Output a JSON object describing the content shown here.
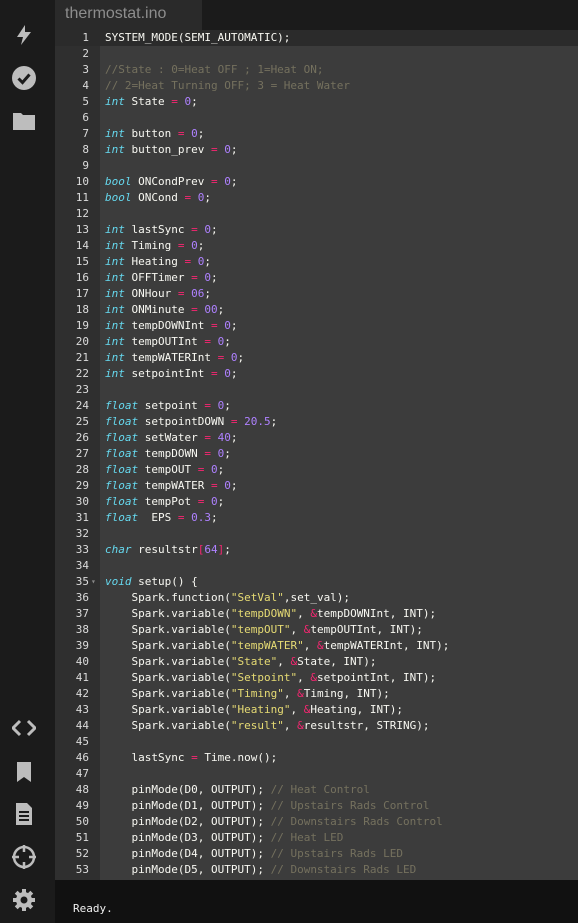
{
  "sidebar": {
    "icons": [
      "flash-icon",
      "verify-icon",
      "folder-icon",
      "code-icon",
      "libraries-icon",
      "docs-icon",
      "devices-icon",
      "settings-icon"
    ]
  },
  "tab": {
    "title": "thermostat.ino"
  },
  "editor": {
    "lines": [
      "SYSTEM_MODE(SEMI_AUTOMATIC);",
      "",
      "//State : 0=Heat OFF ; 1=Heat ON;",
      "// 2=Heat Turning OFF; 3 = Heat Water",
      "int State = 0;",
      "",
      "int button = 0;",
      "int button_prev = 0;",
      "",
      "bool ONCondPrev = 0;",
      "bool ONCond = 0;",
      "",
      "int lastSync = 0;",
      "int Timing = 0;",
      "int Heating = 0;",
      "int OFFTimer = 0;",
      "int ONHour = 06;",
      "int ONMinute = 00;",
      "int tempDOWNInt = 0;",
      "int tempOUTInt = 0;",
      "int tempWATERInt = 0;",
      "int setpointInt = 0;",
      "",
      "float setpoint = 0;",
      "float setpointDOWN = 20.5;",
      "float setWater = 40;",
      "float tempDOWN = 0;",
      "float tempOUT = 0;",
      "float tempWATER = 0;",
      "float tempPot = 0;",
      "float  EPS = 0.3;",
      "",
      "char resultstr[64];",
      "",
      "void setup() {",
      "    Spark.function(\"SetVal\",set_val);",
      "    Spark.variable(\"tempDOWN\", &tempDOWNInt, INT);",
      "    Spark.variable(\"tempOUT\", &tempOUTInt, INT);",
      "    Spark.variable(\"tempWATER\", &tempWATERInt, INT);",
      "    Spark.variable(\"State\", &State, INT);",
      "    Spark.variable(\"Setpoint\", &setpointInt, INT);",
      "    Spark.variable(\"Timing\", &Timing, INT);",
      "    Spark.variable(\"Heating\", &Heating, INT);",
      "    Spark.variable(\"result\", &resultstr, STRING);",
      "",
      "    lastSync = Time.now();",
      "",
      "    pinMode(D0, OUTPUT); // Heat Control",
      "    pinMode(D1, OUTPUT); // Upstairs Rads Control",
      "    pinMode(D2, OUTPUT); // Downstairs Rads Control",
      "    pinMode(D3, OUTPUT); // Heat LED",
      "    pinMode(D4, OUTPUT); // Upstairs Rads LED",
      "    pinMode(D5, OUTPUT); // Downstairs Rads LED"
    ]
  },
  "console": {
    "status": "Ready."
  }
}
